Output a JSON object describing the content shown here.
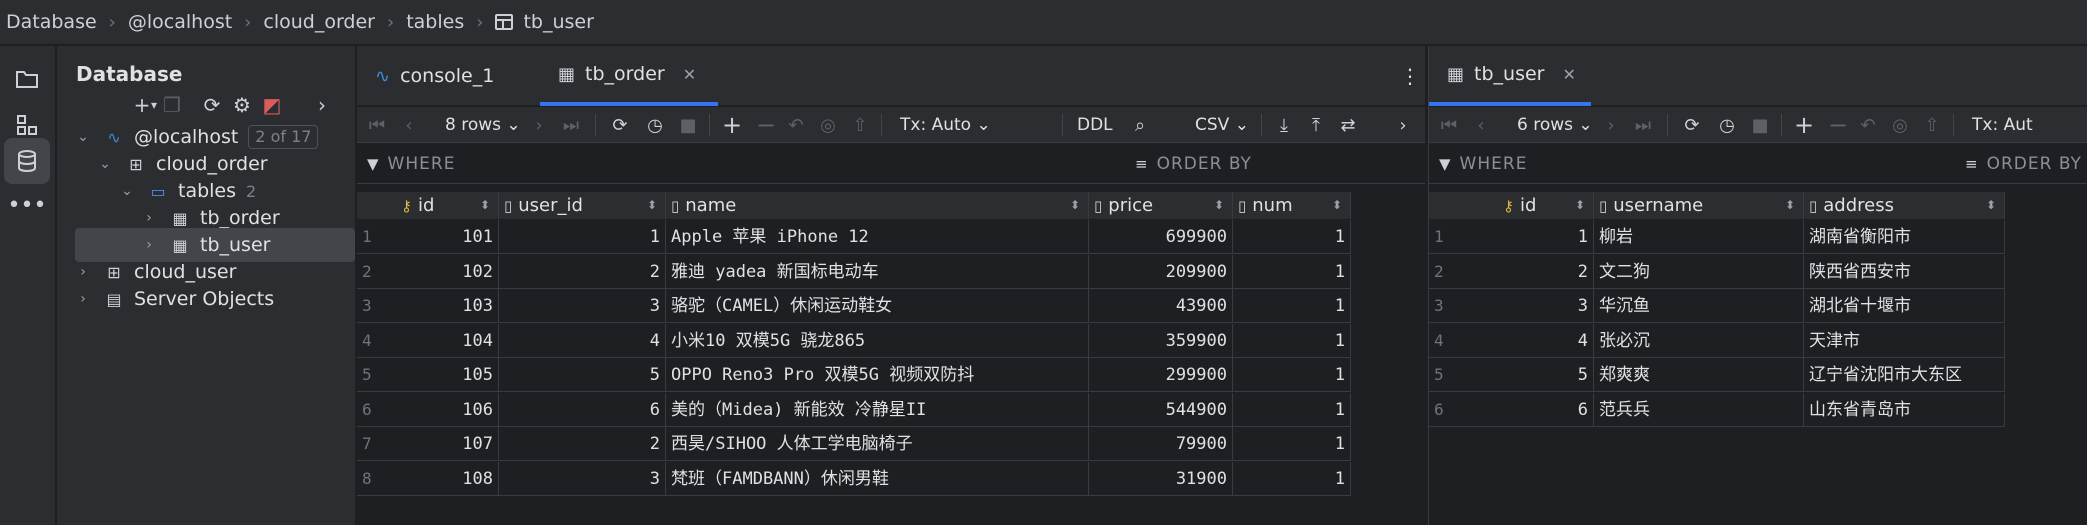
{
  "breadcrumb": [
    "Database",
    "@localhost",
    "cloud_order",
    "tables",
    "tb_user"
  ],
  "sidebar": {
    "title": "Database",
    "tree": [
      {
        "label": "@localhost",
        "badge": "2 of 17"
      },
      {
        "label": "cloud_order"
      },
      {
        "label": "tables",
        "count": "2"
      },
      {
        "label": "tb_order"
      },
      {
        "label": "tb_user"
      },
      {
        "label": "cloud_user"
      },
      {
        "label": "Server Objects"
      }
    ]
  },
  "left": {
    "tabs": [
      {
        "label": "console_1"
      },
      {
        "label": "tb_order"
      }
    ],
    "rows_label": "8 rows",
    "tx_label": "Tx: Auto",
    "ddl_label": "DDL",
    "csv_label": "CSV",
    "where_label": "WHERE",
    "orderby_label": "ORDER BY",
    "columns": [
      "id",
      "user_id",
      "name",
      "price",
      "num"
    ],
    "rows": [
      [
        "1",
        "101",
        "1",
        "Apple 苹果 iPhone 12",
        "699900",
        "1"
      ],
      [
        "2",
        "102",
        "2",
        "雅迪 yadea 新国标电动车",
        "209900",
        "1"
      ],
      [
        "3",
        "103",
        "3",
        "骆驼（CAMEL）休闲运动鞋女",
        "43900",
        "1"
      ],
      [
        "4",
        "104",
        "4",
        "小米10 双模5G 骁龙865",
        "359900",
        "1"
      ],
      [
        "5",
        "105",
        "5",
        "OPPO Reno3 Pro 双模5G 视频双防抖",
        "299900",
        "1"
      ],
      [
        "6",
        "106",
        "6",
        "美的（Midea) 新能效 冷静星II",
        "544900",
        "1"
      ],
      [
        "7",
        "107",
        "2",
        "西昊/SIHOO 人体工学电脑椅子",
        "79900",
        "1"
      ],
      [
        "8",
        "108",
        "3",
        "梵班（FAMDBANN）休闲男鞋",
        "31900",
        "1"
      ]
    ]
  },
  "right": {
    "tabs": [
      {
        "label": "tb_user"
      }
    ],
    "rows_label": "6 rows",
    "tx_label": "Tx: Aut",
    "where_label": "WHERE",
    "orderby_label": "ORDER BY",
    "columns": [
      "id",
      "username",
      "address"
    ],
    "rows": [
      [
        "1",
        "1",
        "柳岩",
        "湖南省衡阳市"
      ],
      [
        "2",
        "2",
        "文二狗",
        "陕西省西安市"
      ],
      [
        "3",
        "3",
        "华沉鱼",
        "湖北省十堰市"
      ],
      [
        "4",
        "4",
        "张必沉",
        "天津市"
      ],
      [
        "5",
        "5",
        "郑爽爽",
        "辽宁省沈阳市大东区"
      ],
      [
        "6",
        "6",
        "范兵兵",
        "山东省青岛市"
      ]
    ]
  },
  "colors": {
    "accent": "#3574f0",
    "key": "#e0b24c",
    "bg": "#1e1f22",
    "panel": "#2b2d30"
  }
}
